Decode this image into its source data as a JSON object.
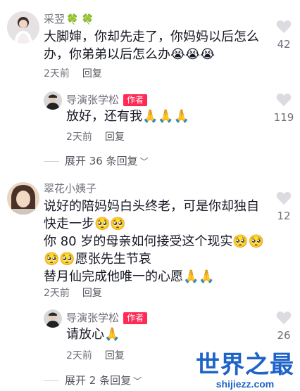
{
  "colors": {
    "accent": "#fe2c55",
    "secondary_text": "#6e6f78",
    "primary_text": "#161823",
    "clover": "#3fae49",
    "watermark": "#1e63c8"
  },
  "comments": [
    {
      "author": "采翌",
      "author_suffix": "🍀 🍀",
      "lines": [
        "大脚婶，你却先走了，你妈妈以后怎么",
        "办，你弟弟以后怎么办"
      ],
      "line2_emoji": "😭😭😭",
      "time": "2天前",
      "reply_label": "回复",
      "likes": "42",
      "replies": [
        {
          "author": "导演张学松",
          "badge": "作者",
          "text": "放好，还有我",
          "emoji": "🙏🙏🙏",
          "time": "2天前",
          "reply_label": "回复",
          "likes": "119"
        }
      ],
      "expand_label": "展开 36 条回复"
    },
    {
      "author": "翠花小姨子",
      "lines": [
        "说好的陪妈妈白头终老，可是你却独自",
        "快走一步",
        "你 80 岁的母亲如何接受这个现实",
        "愿张先生节哀",
        "替月仙完成他唯一的心愿"
      ],
      "line2_emoji": "🥺🥺",
      "line3_emoji": "🥺🥺",
      "line4_emoji_lead": "🥺🥺",
      "line5_emoji": "🙏🙏",
      "time": "2天前",
      "reply_label": "回复",
      "likes": "12",
      "replies": [
        {
          "author": "导演张学松",
          "badge": "作者",
          "text": "请放心",
          "emoji": "🙏",
          "time": "2天前",
          "reply_label": "回复",
          "likes": "26"
        }
      ],
      "expand_label": "展开 2 条回复"
    }
  ],
  "icons": {
    "like": "heart-icon",
    "expand": "chevron-down-icon"
  },
  "watermark": {
    "main": "世界之最",
    "sub": "shijiezz.com"
  }
}
